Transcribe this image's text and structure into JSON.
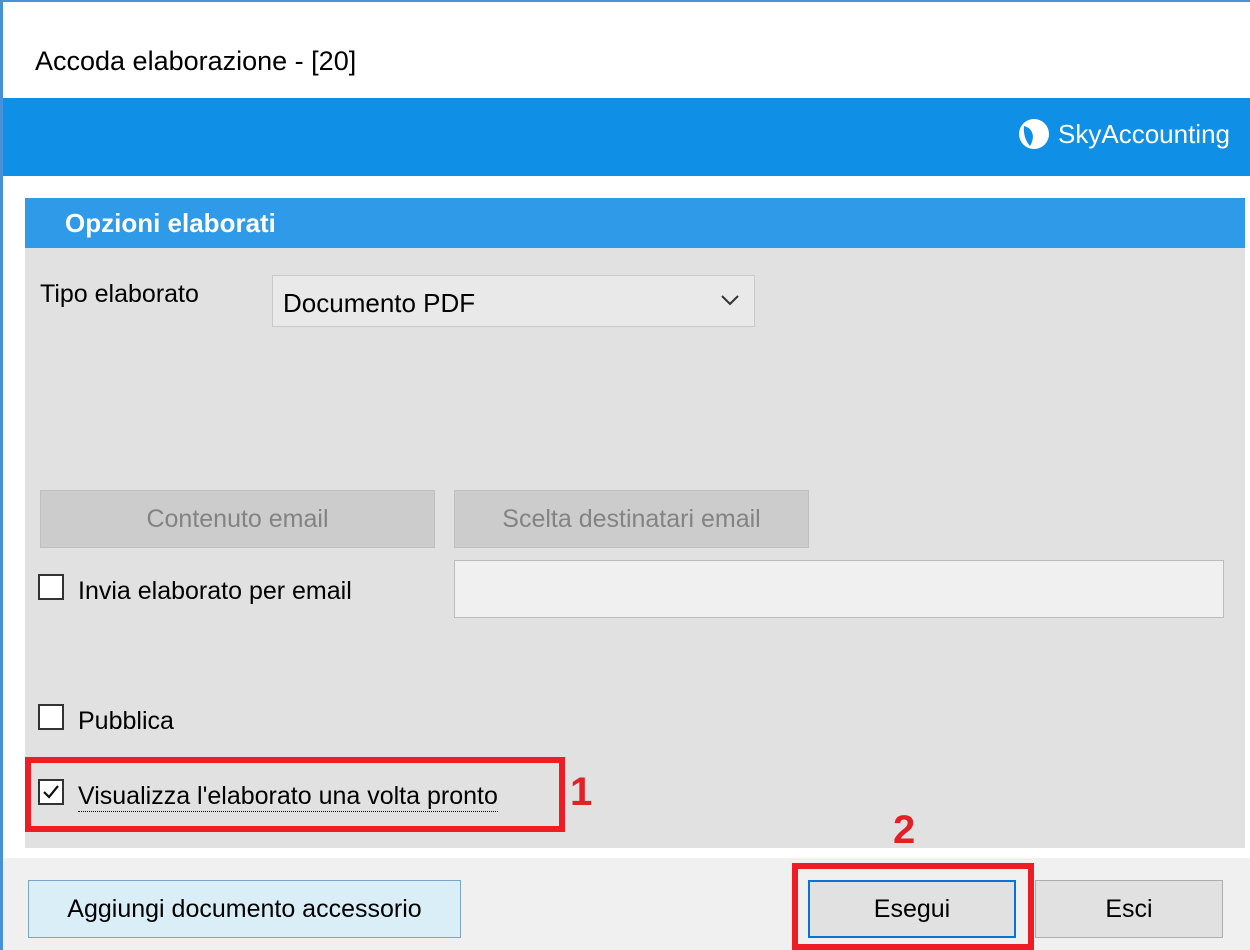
{
  "window": {
    "title": "Accoda elaborazione - [20]"
  },
  "brand": {
    "name": "SkyAccounting",
    "icon": "sky-logo-icon"
  },
  "section": {
    "title": "Opzioni elaborati"
  },
  "tipo": {
    "label": "Tipo elaborato",
    "value": "Documento PDF"
  },
  "buttons": {
    "contenuto_email": "Contenuto email",
    "scelta_destinatari": "Scelta destinatari email",
    "aggiungi_documento": "Aggiungi documento accessorio",
    "esegui": "Esegui",
    "esci": "Esci"
  },
  "options": {
    "invia_email": {
      "label": "Invia elaborato per email",
      "checked": false
    },
    "pubblica": {
      "label": "Pubblica",
      "checked": false
    },
    "visualizza": {
      "label": "Visualizza l'elaborato una volta pronto",
      "checked": true
    }
  },
  "email_field": {
    "value": ""
  },
  "annotations": {
    "first": "1",
    "second": "2"
  },
  "colors": {
    "brand_bar": "#0f8fe6",
    "section_header": "#2f9ae8",
    "highlight": "#ee1c25",
    "accessory_button": "#d9eef7"
  }
}
